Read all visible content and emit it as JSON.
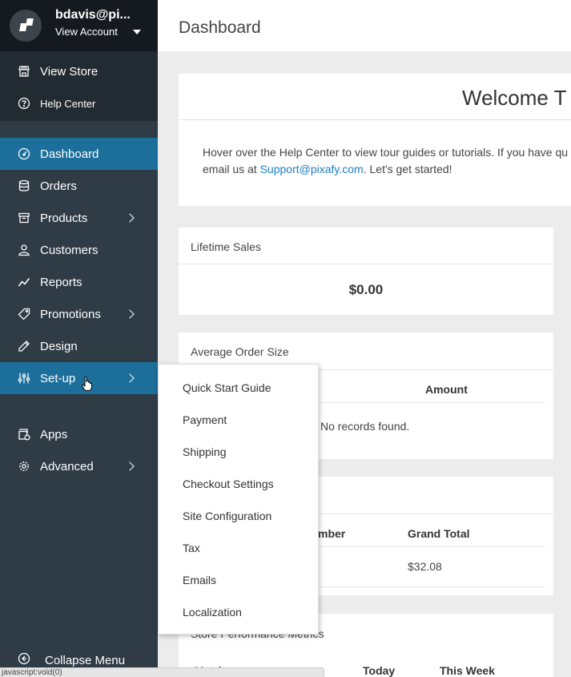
{
  "account": {
    "name": "bdavis@pi...",
    "view_account": "View Account"
  },
  "top_links": [
    {
      "label": "View Store",
      "icon": "store-icon"
    },
    {
      "label": "Help Center",
      "icon": "help-circle-icon"
    }
  ],
  "nav": [
    {
      "label": "Dashboard",
      "icon": "dashboard-gauge-icon",
      "active": true
    },
    {
      "label": "Orders",
      "icon": "database-icon"
    },
    {
      "label": "Products",
      "icon": "archive-box-icon",
      "has_submenu": true
    },
    {
      "label": "Customers",
      "icon": "user-icon"
    },
    {
      "label": "Reports",
      "icon": "trend-line-icon"
    },
    {
      "label": "Promotions",
      "icon": "tag-icon",
      "has_submenu": true
    },
    {
      "label": "Design",
      "icon": "pencil-icon"
    },
    {
      "label": "Set-up",
      "icon": "sliders-icon",
      "has_submenu": true,
      "hovered": true
    },
    {
      "label": "Apps",
      "icon": "apps-icon"
    },
    {
      "label": "Advanced",
      "icon": "gear-icon",
      "has_submenu": true
    }
  ],
  "collapse_label": "Collapse Menu",
  "header": {
    "title": "Dashboard"
  },
  "welcome": {
    "title": "Welcome T",
    "line1": "Hover over the Help Center to view tour guides or tutorials. If you have qu",
    "line2_prefix": "email us at ",
    "email": "Support@pixafy.com",
    "line2_suffix": ". Let's get started!"
  },
  "lifetime_sales": {
    "title": "Lifetime Sales",
    "value": "$0.00"
  },
  "average_order": {
    "title": "Average Order Size",
    "amount_header": "Amount",
    "empty_text": "No records found."
  },
  "recent_orders": {
    "col_number": "mber",
    "col_total": "Grand Total",
    "total_value": "$32.08"
  },
  "performance": {
    "title": "Store Performance Metrics",
    "col_metric": "Metri",
    "col_today": "Today",
    "col_week": "This Week"
  },
  "setup_menu": [
    "Quick Start Guide",
    "Payment",
    "Shipping",
    "Checkout Settings",
    "Site Configuration",
    "Tax",
    "Emails",
    "Localization"
  ],
  "status_bar": "javascript:void(0)",
  "colors": {
    "sidebar": "#2f3c46",
    "sidebar_dark": "#141a1f",
    "active": "#1c6f9a",
    "link": "#1c7fc0"
  }
}
